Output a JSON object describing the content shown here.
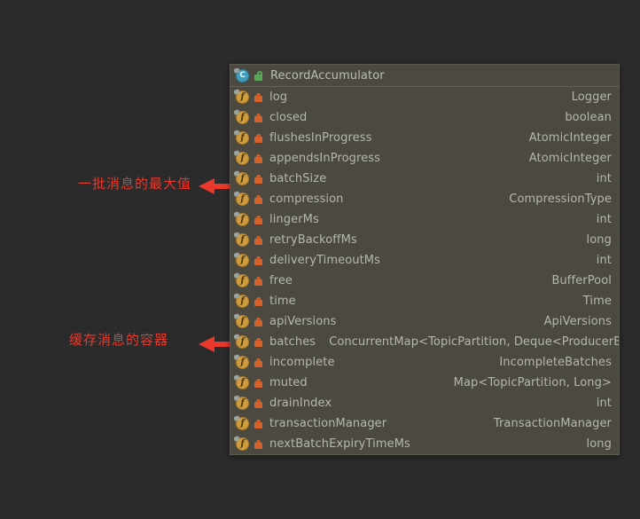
{
  "window": {
    "background_color": "#2b2b2b",
    "popup_background_color": "#4c4a40",
    "annotation_color": "#e8392c"
  },
  "popup": {
    "header": {
      "title": "RecordAccumulator",
      "class_icon": "class-icon",
      "visibility_icon": "package-lock-icon"
    },
    "rows": [
      {
        "icon": "field-icon",
        "access": "private-lock-icon",
        "name": "log",
        "type": "Logger",
        "inline": false
      },
      {
        "icon": "field-icon",
        "access": "private-lock-icon",
        "name": "closed",
        "type": "boolean",
        "inline": false
      },
      {
        "icon": "field-icon",
        "access": "private-lock-icon",
        "name": "flushesInProgress",
        "type": "AtomicInteger",
        "inline": false
      },
      {
        "icon": "field-icon",
        "access": "private-lock-icon",
        "name": "appendsInProgress",
        "type": "AtomicInteger",
        "inline": false
      },
      {
        "icon": "field-icon",
        "access": "private-lock-icon",
        "name": "batchSize",
        "type": "int",
        "inline": false
      },
      {
        "icon": "field-icon",
        "access": "private-lock-icon",
        "name": "compression",
        "type": "CompressionType",
        "inline": false
      },
      {
        "icon": "field-icon",
        "access": "private-lock-icon",
        "name": "lingerMs",
        "type": "int",
        "inline": false
      },
      {
        "icon": "field-icon",
        "access": "private-lock-icon",
        "name": "retryBackoffMs",
        "type": "long",
        "inline": false
      },
      {
        "icon": "field-icon",
        "access": "private-lock-icon",
        "name": "deliveryTimeoutMs",
        "type": "int",
        "inline": false
      },
      {
        "icon": "field-icon",
        "access": "private-lock-icon",
        "name": "free",
        "type": "BufferPool",
        "inline": false
      },
      {
        "icon": "field-icon",
        "access": "private-lock-icon",
        "name": "time",
        "type": "Time",
        "inline": false
      },
      {
        "icon": "field-icon",
        "access": "private-lock-icon",
        "name": "apiVersions",
        "type": "ApiVersions",
        "inline": false
      },
      {
        "icon": "field-icon",
        "access": "private-lock-icon",
        "name": "batches",
        "type": "ConcurrentMap<TopicPartition, Deque<ProducerBatch>>",
        "inline": true
      },
      {
        "icon": "field-icon",
        "access": "private-lock-icon",
        "name": "incomplete",
        "type": "IncompleteBatches",
        "inline": false
      },
      {
        "icon": "field-icon",
        "access": "private-lock-icon",
        "name": "muted",
        "type": "Map<TopicPartition, Long>",
        "inline": false
      },
      {
        "icon": "field-icon",
        "access": "private-lock-icon",
        "name": "drainIndex",
        "type": "int",
        "inline": false
      },
      {
        "icon": "field-icon",
        "access": "private-lock-icon",
        "name": "transactionManager",
        "type": "TransactionManager",
        "inline": false
      },
      {
        "icon": "field-icon",
        "access": "private-lock-icon",
        "name": "nextBatchExpiryTimeMs",
        "type": "long",
        "inline": false
      }
    ]
  },
  "annotations": [
    {
      "text": "一批消息的最大值",
      "target_row": "batchSize",
      "arrow_icon": "left-arrow-icon"
    },
    {
      "text": "缓存消息的容器",
      "target_row": "batches",
      "arrow_icon": "left-arrow-icon"
    }
  ]
}
